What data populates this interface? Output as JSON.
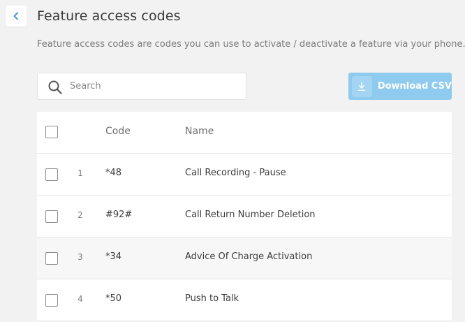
{
  "page": {
    "title": "Feature access codes",
    "description": "Feature access codes are codes you can use to activate / deactivate a feature via your phone."
  },
  "search": {
    "placeholder": "Search",
    "value": ""
  },
  "download": {
    "label": "Download CSV"
  },
  "table": {
    "columns": {
      "code": "Code",
      "name": "Name"
    },
    "rows": [
      {
        "index": "1",
        "code": "*48",
        "name": "Call Recording - Pause"
      },
      {
        "index": "2",
        "code": "#92#",
        "name": "Call Return Number Deletion"
      },
      {
        "index": "3",
        "code": "*34",
        "name": "Advice Of Charge Activation"
      },
      {
        "index": "4",
        "code": "*50",
        "name": "Push to Talk"
      }
    ]
  },
  "icons": {
    "back": "chevron-left-icon",
    "search": "search-icon",
    "download": "download-icon"
  },
  "colors": {
    "accent": "#2a8fd0",
    "download_button": "#8fcbee",
    "background": "#f2f2f2"
  }
}
